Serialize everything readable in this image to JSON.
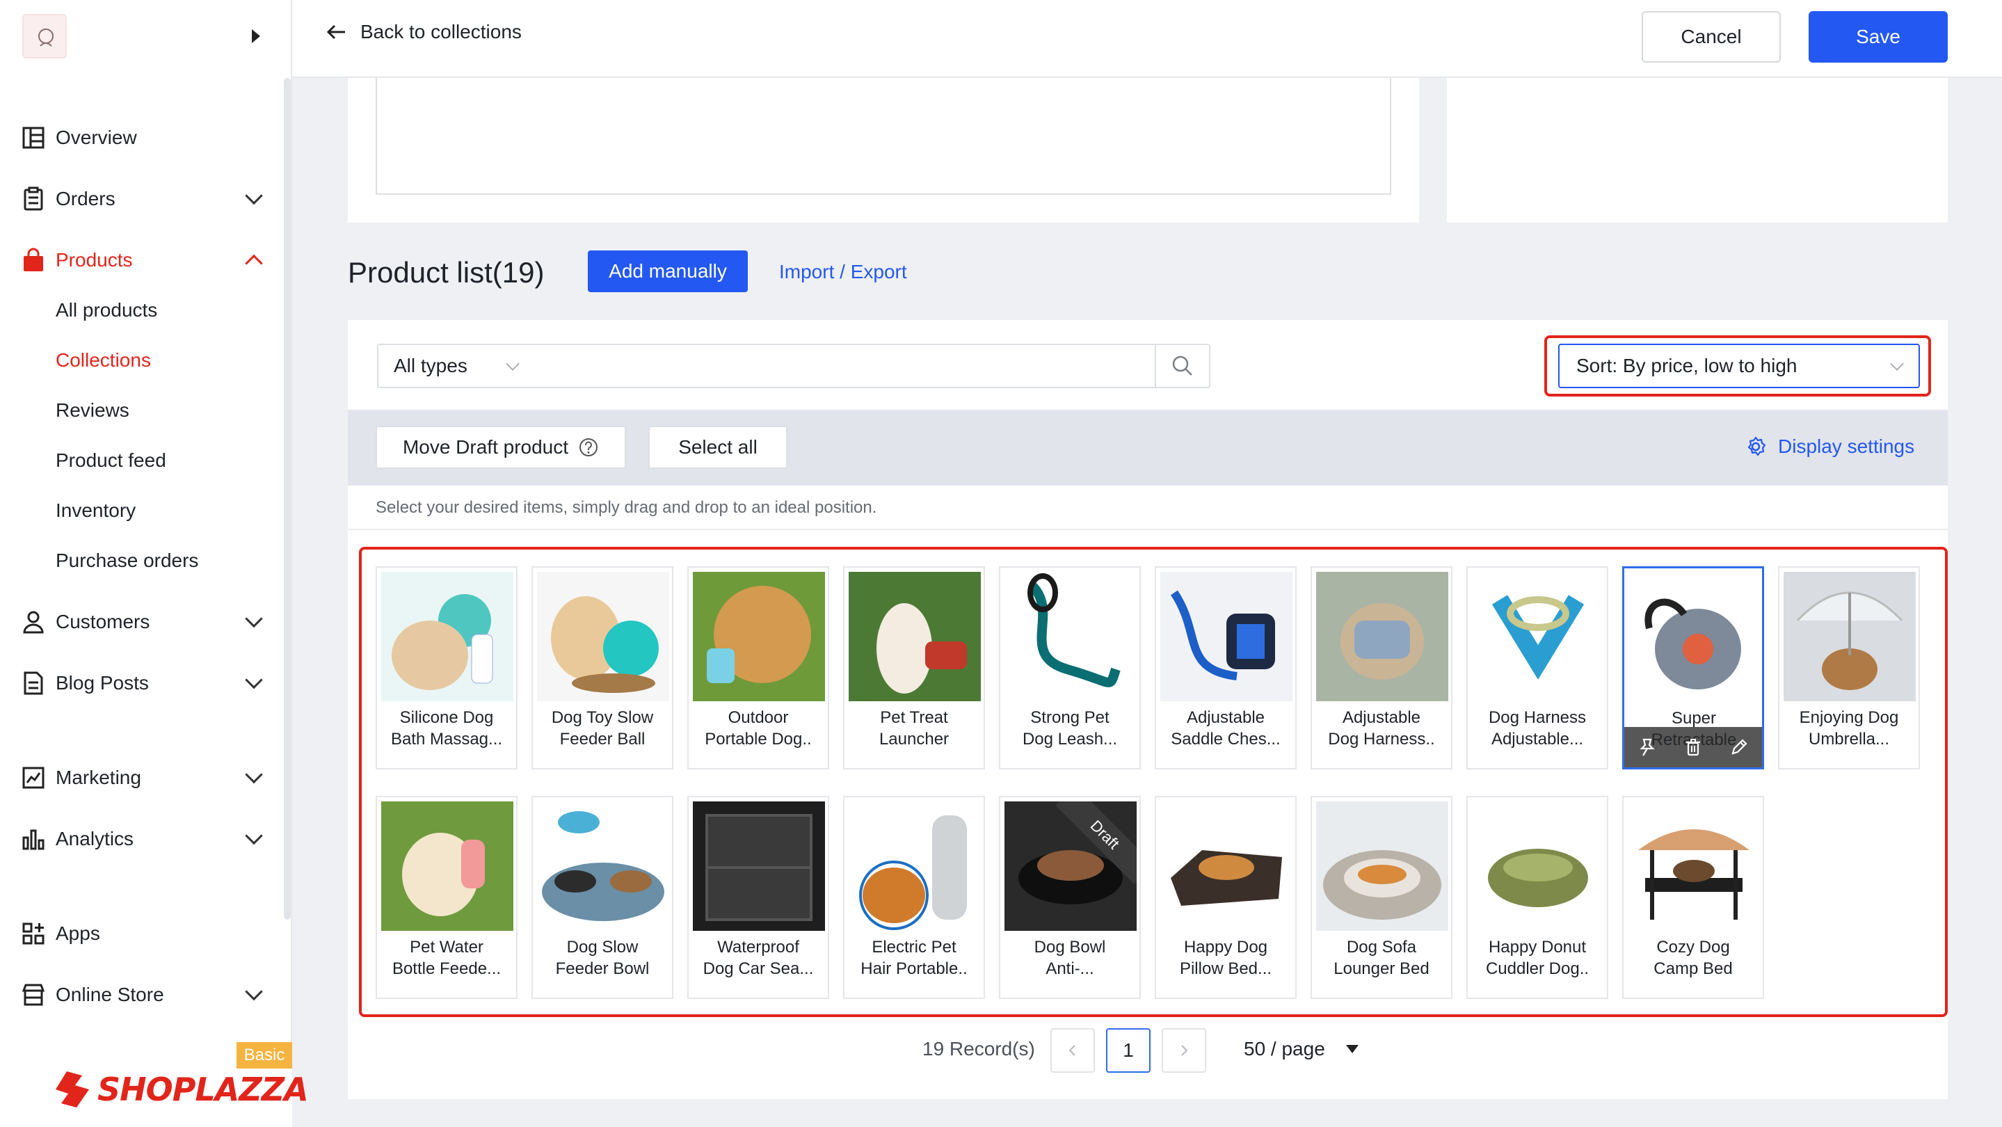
{
  "sidebar": {
    "nav": [
      {
        "label": "Overview",
        "icon": "overview-icon",
        "chevron": false
      },
      {
        "label": "Orders",
        "icon": "orders-icon",
        "chevron": true
      },
      {
        "label": "Products",
        "icon": "products-bag-icon",
        "chevron": true,
        "active": true
      },
      {
        "label": "Customers",
        "icon": "customers-icon",
        "chevron": true
      },
      {
        "label": "Blog Posts",
        "icon": "blog-icon",
        "chevron": true
      },
      {
        "label": "Marketing",
        "icon": "marketing-icon",
        "chevron": true
      },
      {
        "label": "Analytics",
        "icon": "analytics-icon",
        "chevron": true
      },
      {
        "label": "Apps",
        "icon": "apps-icon",
        "chevron": false
      },
      {
        "label": "Online Store",
        "icon": "store-icon",
        "chevron": true
      }
    ],
    "products_sub": [
      "All products",
      "Collections",
      "Reviews",
      "Product feed",
      "Inventory",
      "Purchase orders"
    ],
    "products_sub_active": "Collections",
    "plan_badge": "Basic",
    "brand": "SHOPLAZZA"
  },
  "topbar": {
    "back_label": "Back to collections",
    "cancel_label": "Cancel",
    "save_label": "Save"
  },
  "product_list": {
    "title": "Product list(19)",
    "add_manually": "Add manually",
    "import_export": "Import / Export",
    "type_filter": "All types",
    "search_placeholder": "",
    "sort_label": "Sort: By price, low to high",
    "move_draft": "Move Draft product",
    "select_all": "Select all",
    "display_settings": "Display settings",
    "hint": "Select your desired items, simply drag and drop to an ideal position."
  },
  "products": [
    {
      "line1": "Silicone Dog",
      "line2": "Bath Massag..."
    },
    {
      "line1": "Dog Toy Slow",
      "line2": "Feeder Ball"
    },
    {
      "line1": "Outdoor",
      "line2": "Portable Dog.."
    },
    {
      "line1": "Pet Treat",
      "line2": "Launcher"
    },
    {
      "line1": "Strong Pet",
      "line2": "Dog Leash..."
    },
    {
      "line1": "Adjustable",
      "line2": "Saddle Ches..."
    },
    {
      "line1": "Adjustable",
      "line2": "Dog Harness.."
    },
    {
      "line1": "Dog Harness",
      "line2": "Adjustable..."
    },
    {
      "line1": "Super",
      "line2": "Retractable",
      "selected": true
    },
    {
      "line1": "Enjoying Dog",
      "line2": "Umbrella..."
    },
    {
      "line1": "Pet Water",
      "line2": "Bottle Feede..."
    },
    {
      "line1": "Dog Slow",
      "line2": "Feeder Bowl"
    },
    {
      "line1": "Waterproof",
      "line2": "Dog Car Sea..."
    },
    {
      "line1": "Electric Pet",
      "line2": "Hair Portable.."
    },
    {
      "line1": "Dog Bowl",
      "line2": "Anti-...",
      "draft": true
    },
    {
      "line1": "Happy Dog",
      "line2": "Pillow Bed..."
    },
    {
      "line1": "Dog Sofa",
      "line2": "Lounger Bed"
    },
    {
      "line1": "Happy Donut",
      "line2": "Cuddler Dog.."
    },
    {
      "line1": "Cozy Dog",
      "line2": "Camp Bed"
    }
  ],
  "draft_badge": "Draft",
  "pagination": {
    "records": "19 Record(s)",
    "current_page": "1",
    "per_page": "50 / page"
  },
  "colors": {
    "accent_red": "#e1251b",
    "primary_blue": "#2358f2",
    "badge_orange": "#f5b340"
  }
}
